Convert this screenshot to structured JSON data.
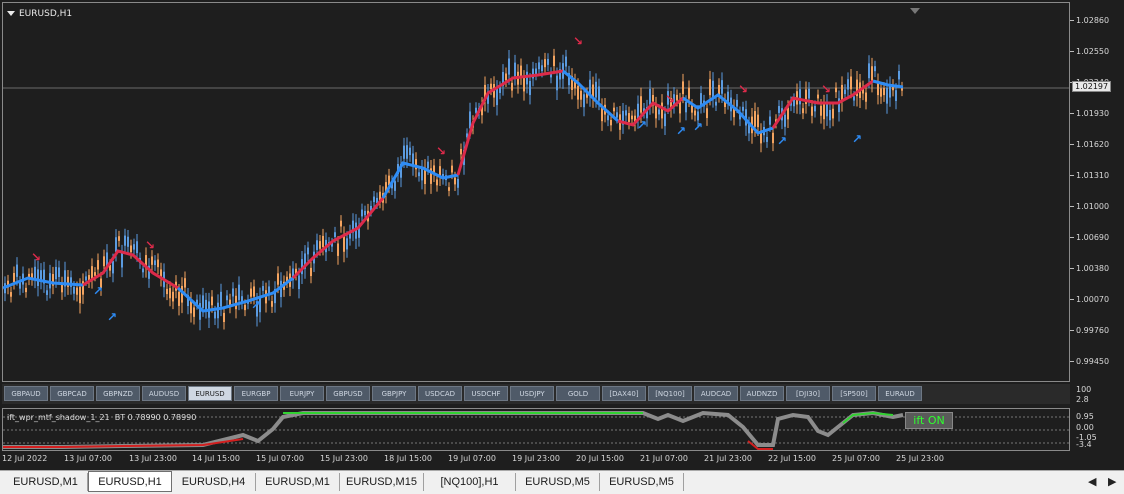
{
  "chart": {
    "title": "EURUSD,H1",
    "current_price": "1.02197",
    "price_labels": [
      "1.02860",
      "1.02550",
      "1.02240",
      "1.01930",
      "1.01620",
      "1.01310",
      "1.01000",
      "1.00690",
      "1.00380",
      "1.00070",
      "0.99760",
      "0.99450"
    ],
    "colors": {
      "background": "#1e1e1e",
      "bull_line": "#2e8cf5",
      "bear_line": "#dc2a4a",
      "candle_up": "#f4a460",
      "candle_down": "#5b9be0"
    }
  },
  "symbols": [
    "GBPAUD",
    "GBPCAD",
    "GBPNZD",
    "AUDUSD",
    "EURUSD",
    "EURGBP",
    "EURJPY",
    "GBPUSD",
    "GBPJPY",
    "USDCAD",
    "USDCHF",
    "USDJPY",
    "GOLD",
    "[DAX40]",
    "[NQ100]",
    "AUDCAD",
    "AUDNZD",
    "[DJI30]",
    "[SP500]",
    "EURAUD"
  ],
  "active_symbol": "EURUSD",
  "indicator": {
    "name": "ift_wpr_mtf_shadow_1_21",
    "bt_label": "BT",
    "value1": "0.78990",
    "value2": "0.78990",
    "badge": "ift ON",
    "axis_labels": [
      "100",
      "2.8",
      "0.95",
      "0.00",
      "-1.05",
      "-3.4"
    ],
    "colors": {
      "shadow": "#8c8c8c",
      "up": "#32d232",
      "down": "#d21e1e",
      "level": "#777777"
    }
  },
  "time_labels": [
    "12 Jul 2022",
    "13 Jul 07:00",
    "13 Jul 23:00",
    "14 Jul 15:00",
    "15 Jul 07:00",
    "15 Jul 23:00",
    "18 Jul 15:00",
    "19 Jul 07:00",
    "19 Jul 23:00",
    "20 Jul 15:00",
    "21 Jul 07:00",
    "21 Jul 23:00",
    "22 Jul 15:00",
    "25 Jul 07:00",
    "25 Jul 23:00"
  ],
  "tabs": [
    "EURUSD,M1",
    "EURUSD,H1",
    "EURUSD,H4",
    "EURUSD,M1",
    "EURUSD,M15",
    "[NQ100],H1",
    "EURUSD,M5",
    "EURUSD,M5"
  ],
  "active_tab_index": 1
}
